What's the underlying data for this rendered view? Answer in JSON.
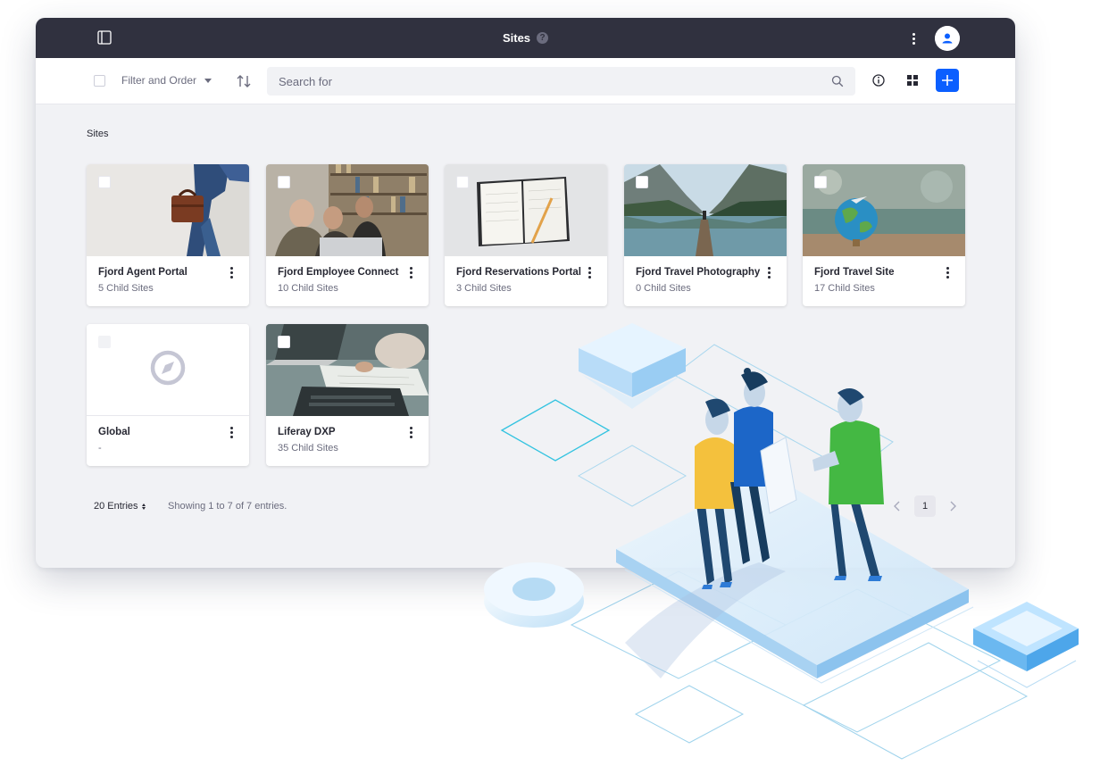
{
  "header": {
    "title": "Sites",
    "help_glyph": "?",
    "icons": [
      "sidebar-toggle-icon",
      "kebab-icon",
      "user-avatar-icon"
    ]
  },
  "toolbar": {
    "filter_label": "Filter and Order",
    "search_placeholder": "Search for",
    "search_value": "",
    "icons": [
      "sort-icon",
      "search-icon",
      "info-icon",
      "cards-view-icon",
      "plus-icon"
    ],
    "accent_color": "#0b5fff"
  },
  "section_title": "Sites",
  "sites": [
    {
      "name": "Fjord Agent Portal",
      "subtitle": "5 Child Sites"
    },
    {
      "name": "Fjord Employee Connect",
      "subtitle": "10 Child Sites"
    },
    {
      "name": "Fjord Reservations Portal",
      "subtitle": "3 Child Sites"
    },
    {
      "name": "Fjord Travel Photography",
      "subtitle": "0 Child Sites"
    },
    {
      "name": "Fjord Travel Site",
      "subtitle": "17 Child Sites"
    },
    {
      "name": "Global",
      "subtitle": "-"
    },
    {
      "name": "Liferay DXP",
      "subtitle": "35 Child Sites"
    }
  ],
  "pagination": {
    "entries_label": "20 Entries",
    "showing": "Showing 1 to 7 of 7 entries.",
    "current_page": "1"
  },
  "colors": {
    "titlebar": "#30313f",
    "background": "#f1f2f5"
  }
}
